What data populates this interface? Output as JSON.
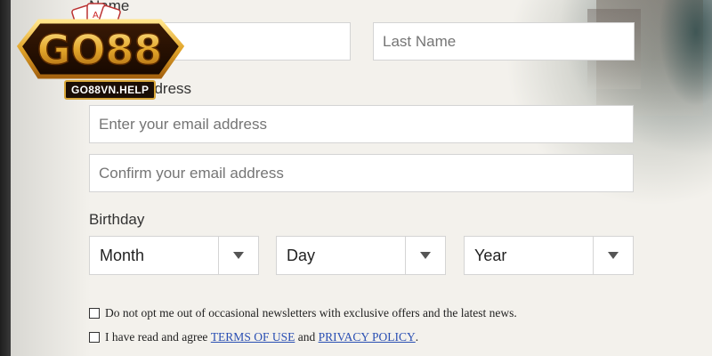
{
  "logo": {
    "wordmark": "GO88",
    "url": "GO88VN.HELP"
  },
  "name_section": {
    "label": "Name",
    "first_name_placeholder": "",
    "last_name_placeholder": "Last Name"
  },
  "email_section": {
    "label_partial": "ddress",
    "email_placeholder": "Enter your email address",
    "confirm_placeholder": "Confirm your email address"
  },
  "birthday": {
    "label": "Birthday",
    "month": "Month",
    "day": "Day",
    "year": "Year"
  },
  "checkboxes": {
    "newsletter": "Do not opt me out of occasional newsletters with exclusive offers and the latest news.",
    "agree_prefix": "I have read and agree ",
    "terms_link": "TERMS OF USE",
    "and_text": " and ",
    "privacy_link": "PRIVACY POLICY",
    "suffix": "."
  }
}
